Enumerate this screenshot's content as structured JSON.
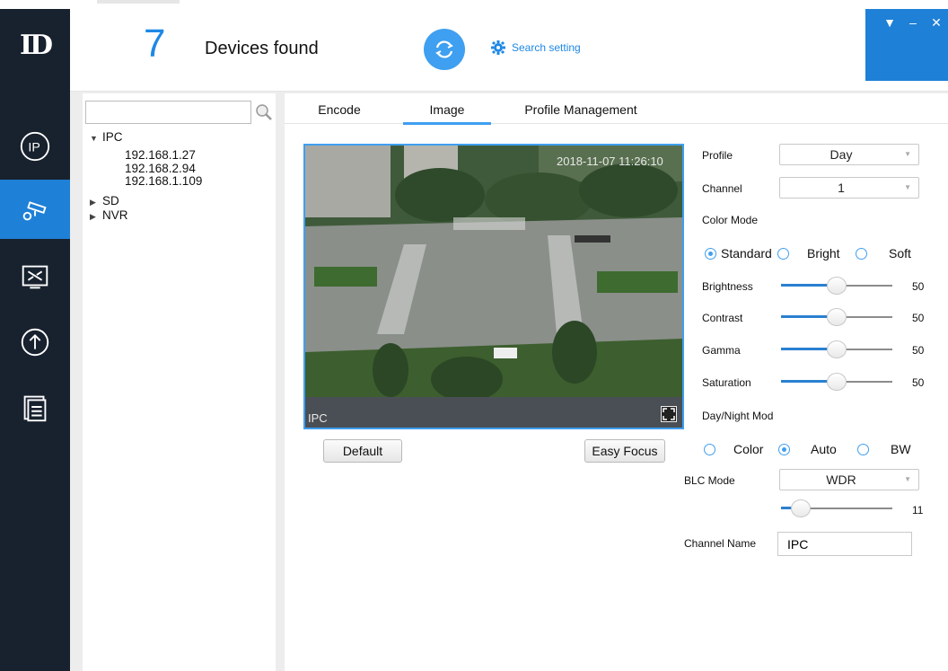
{
  "app": {
    "logo_text": "ID"
  },
  "header": {
    "device_count": "7",
    "devices_found_label": "Devices found",
    "search_setting_label": "Search setting",
    "window_controls": {
      "menu": "▼",
      "minimize": "–",
      "close": "✕"
    }
  },
  "sidebar": {
    "items": [
      {
        "icon": "ip-icon",
        "active": false
      },
      {
        "icon": "camera-settings-icon",
        "active": true
      },
      {
        "icon": "tools-icon",
        "active": false
      },
      {
        "icon": "upgrade-icon",
        "active": false
      },
      {
        "icon": "documents-icon",
        "active": false
      }
    ],
    "accent": "#1e80d6",
    "bg": "#18212e"
  },
  "device_tree": {
    "search_placeholder": "",
    "groups": [
      {
        "label": "IPC",
        "expanded": true,
        "children": [
          "192.168.1.27",
          "192.168.2.94",
          "192.168.1.109"
        ]
      },
      {
        "label": "SD",
        "expanded": false,
        "children": []
      },
      {
        "label": "NVR",
        "expanded": false,
        "children": []
      }
    ]
  },
  "tabs": [
    {
      "label": "Encode",
      "active": false
    },
    {
      "label": "Image",
      "active": true
    },
    {
      "label": "Profile Management",
      "active": false
    }
  ],
  "video": {
    "timestamp": "2018-11-07 11:26:10",
    "channel_overlay": "IPC",
    "default_button": "Default",
    "easy_focus_button": "Easy Focus"
  },
  "settings": {
    "profile": {
      "label": "Profile",
      "value": "Day"
    },
    "channel": {
      "label": "Channel",
      "value": "1"
    },
    "color_mode": {
      "label": "Color Mode",
      "options": [
        "Standard",
        "Bright",
        "Soft"
      ],
      "selected": "Standard"
    },
    "sliders": [
      {
        "label": "Brightness",
        "value": 50,
        "max": 100
      },
      {
        "label": "Contrast",
        "value": 50,
        "max": 100
      },
      {
        "label": "Gamma",
        "value": 50,
        "max": 100
      },
      {
        "label": "Saturation",
        "value": 50,
        "max": 100
      }
    ],
    "day_night": {
      "label": "Day/Night Mod",
      "options": [
        "Color",
        "Auto",
        "BW"
      ],
      "selected": "Auto"
    },
    "blc_mode": {
      "label": "BLC Mode",
      "value": "WDR",
      "level": 11,
      "max": 100
    },
    "channel_name": {
      "label": "Channel Name",
      "value": "IPC"
    }
  }
}
